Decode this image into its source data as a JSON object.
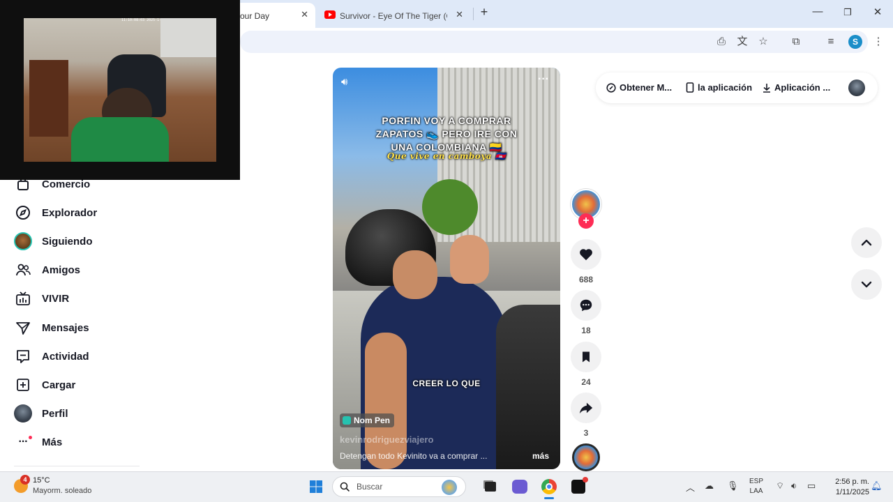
{
  "browser": {
    "tabs": [
      {
        "title": "our Day",
        "active": true
      },
      {
        "title": "Survivor - Eye Of The Tiger (Offi",
        "active": false
      }
    ],
    "new_tab": "+",
    "profile_initial": "S"
  },
  "webcam": {
    "overlay_text": "11:10:08:03 2025-1-31 | 4ee7: 4444 AEIBKYOD"
  },
  "sidebar": {
    "items": [
      {
        "label": "Comercio",
        "icon": "shop-icon"
      },
      {
        "label": "Explorador",
        "icon": "compass-icon"
      },
      {
        "label": "Siguiendo",
        "icon": "avatar-icon"
      },
      {
        "label": "Amigos",
        "icon": "friends-icon"
      },
      {
        "label": "VIVIR",
        "icon": "live-tv-icon"
      },
      {
        "label": "Mensajes",
        "icon": "send-icon"
      },
      {
        "label": "Actividad",
        "icon": "message-box-icon"
      },
      {
        "label": "Cargar",
        "icon": "upload-plus-icon"
      },
      {
        "label": "Perfil",
        "icon": "profile-avatar-icon"
      },
      {
        "label": "Más",
        "icon": "more-dots-icon"
      }
    ]
  },
  "video": {
    "caption_lines": [
      "PORFIN VOY A COMPRAR",
      "ZAPATOS 👟 PERO IRE CON",
      "UNA COLOMBIANA 🇨🇴"
    ],
    "caption_script": "Que vive en camboya 🇰🇭",
    "subtitle": "CREER LO QUE",
    "location": "Nom Pen",
    "username": "kevinrodriguezviajero",
    "description": "Detengan todo Kevinito va a comprar ...",
    "more_label": "más"
  },
  "actions": {
    "likes": "688",
    "comments": "18",
    "saves": "24",
    "shares": "3"
  },
  "topbar": {
    "get_coins": "Obtener M...",
    "app": "la aplicación",
    "download": "Aplicación ..."
  },
  "taskbar": {
    "weather_temp": "15°C",
    "weather_desc": "Mayorm. soleado",
    "weather_badge": "4",
    "search_placeholder": "Buscar",
    "lang_top": "ESP",
    "lang_bottom": "LAA",
    "time": "2:56 p. m.",
    "date": "1/11/2025"
  },
  "colors": {
    "accent": "#fe2c55",
    "tab_strip": "#dfe9f8",
    "text_primary": "#161823"
  }
}
